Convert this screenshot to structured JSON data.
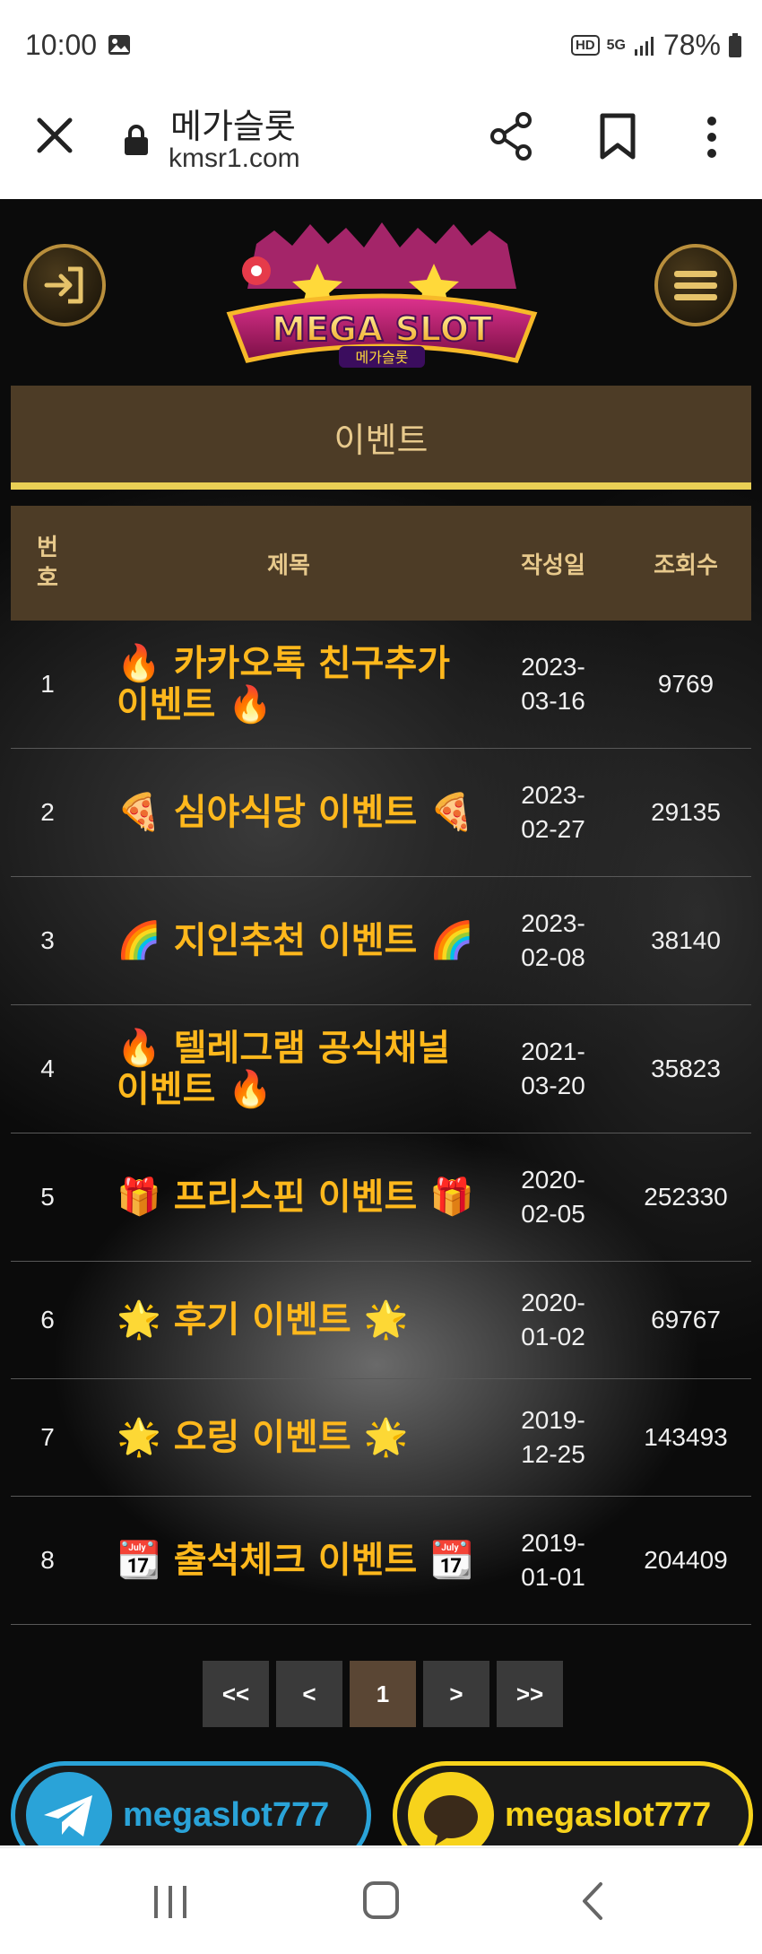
{
  "status_bar": {
    "time": "10:00",
    "hd": "HD",
    "network": "5G",
    "battery": "78%"
  },
  "browser": {
    "site_title": "메가슬롯",
    "host": "kmsr1.com"
  },
  "header": {
    "logo_text": "MEGA SLOT",
    "logo_sub": "메가슬롯"
  },
  "section": {
    "title": "이벤트"
  },
  "table": {
    "columns": {
      "number": "번\n호",
      "title": "제목",
      "date": "작성일",
      "views": "조회수"
    },
    "rows": [
      {
        "number": "1",
        "title": "🔥 카카오톡 친구추가 이벤트 🔥",
        "date": "2023-\n03-16",
        "views": "9769"
      },
      {
        "number": "2",
        "title": "🍕 심야식당 이벤트 🍕",
        "date": "2023-\n02-27",
        "views": "29135"
      },
      {
        "number": "3",
        "title": "🌈 지인추천 이벤트 🌈",
        "date": "2023-\n02-08",
        "views": "38140"
      },
      {
        "number": "4",
        "title": "🔥 텔레그램 공식채널 이벤트 🔥",
        "date": "2021-\n03-20",
        "views": "35823"
      },
      {
        "number": "5",
        "title": "🎁 프리스핀 이벤트 🎁",
        "date": "2020-\n02-05",
        "views": "252330"
      },
      {
        "number": "6",
        "title": "🌟 후기 이벤트 🌟",
        "date": "2020-\n01-02",
        "views": "69767"
      },
      {
        "number": "7",
        "title": "🌟 오링 이벤트 🌟",
        "date": "2019-\n12-25",
        "views": "143493"
      },
      {
        "number": "8",
        "title": "📆 출석체크 이벤트 📆",
        "date": "2019-\n01-01",
        "views": "204409"
      }
    ]
  },
  "pagination": {
    "first": "<<",
    "prev": "<",
    "current": "1",
    "next": ">",
    "last": ">>"
  },
  "contacts": {
    "telegram": "megaslot777",
    "kakao": "megaslot777"
  },
  "colors": {
    "gold": "#ffb81c",
    "header_bg": "#4d3c26",
    "header_text": "#e7c98c",
    "accent_line": "#e9cf55",
    "telegram": "#2aa3d8",
    "kakao": "#f7d31c"
  }
}
